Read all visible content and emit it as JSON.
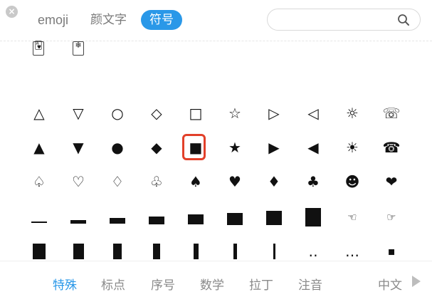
{
  "tabs": {
    "emoji": "emoji",
    "kaomoji": "颜文字",
    "symbols": "符号"
  },
  "search": {
    "placeholder": ""
  },
  "top_cards": [
    "🂱",
    "❄"
  ],
  "symbols": {
    "row1": [
      "△",
      "▽",
      "○",
      "◇",
      "□",
      "☆",
      "▷",
      "◁",
      "☼",
      "☏"
    ],
    "row2": [
      "▲",
      "▼",
      "●",
      "◆",
      "■",
      "★",
      "▶",
      "◀",
      "☀",
      "☎"
    ],
    "row3": [
      "♤",
      "♡",
      "♢",
      "♧",
      "♠",
      "♥",
      "♦",
      "♣",
      "☻",
      "❤"
    ],
    "row4_extra": [
      "☜",
      "☞"
    ],
    "row5_extra": [
      "‥",
      "…",
      "▪"
    ]
  },
  "selected_symbol": "■",
  "categories": [
    "特殊",
    "标点",
    "序号",
    "数学",
    "拉丁",
    "注音",
    "中文"
  ],
  "accent_color": "#2a98e8",
  "selection_color": "#e2402a"
}
